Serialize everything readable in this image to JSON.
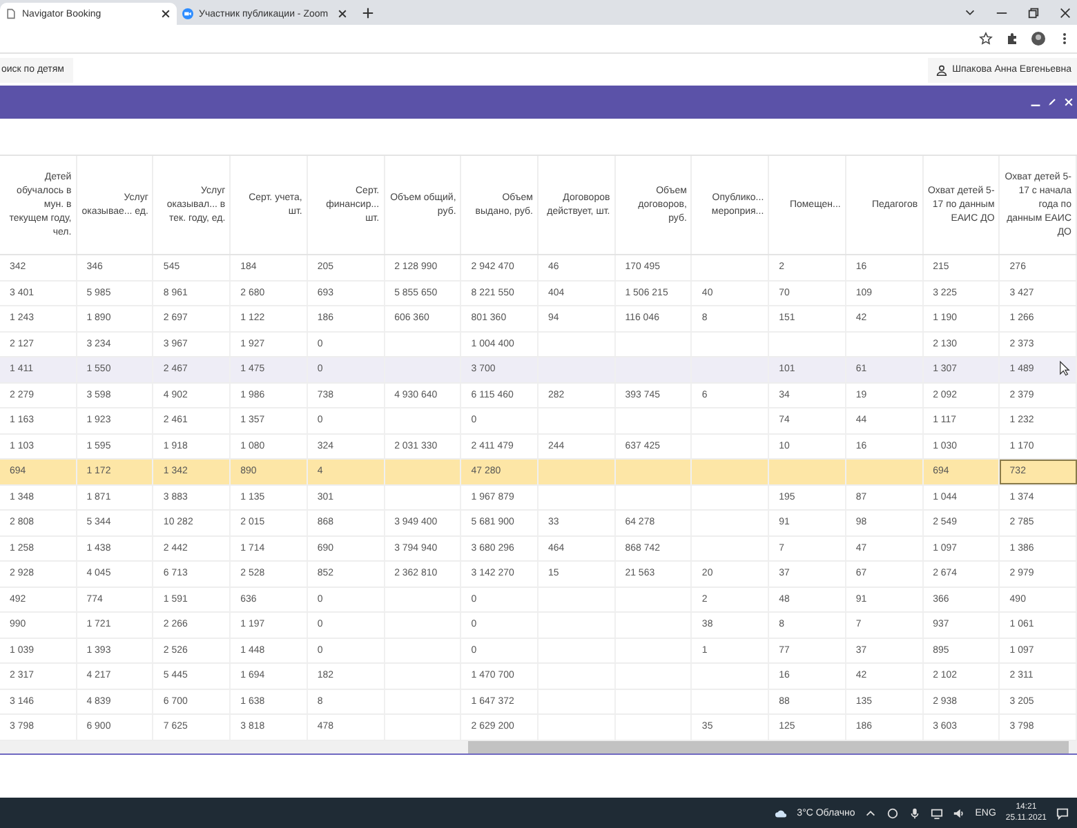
{
  "browser": {
    "tabs": [
      {
        "title": "Navigator Booking",
        "selected": true
      },
      {
        "title": "Участник публикации - Zoom",
        "selected": false
      }
    ]
  },
  "header": {
    "search_button": "оиск по детям",
    "user": "Шпакова Анна Евгеньевна"
  },
  "table": {
    "columns": [
      "Детей обучалось в мун. в текущем году, чел.",
      "Услуг оказывае... ед.",
      "Услуг оказывал... в тек. году, ед.",
      "Серт. учета, шт.",
      "Серт. финансир... шт.",
      "Объем общий, руб.",
      "Объем выдано, руб.",
      "Договоров действует, шт.",
      "Объем договоров, руб.",
      "Опублико... мероприя...",
      "Помещен...",
      "Педагогов",
      "Охват детей 5-17 по данным ЕАИС ДО",
      "Охват детей 5-17 с начала года по данным ЕАИС ДО"
    ],
    "rows": [
      {
        "selected": false,
        "hovered": false,
        "cells": [
          "342",
          "346",
          "545",
          "184",
          "205",
          "2 128 990",
          "2 942 470",
          "46",
          "170 495",
          null,
          "2",
          "16",
          "215",
          "276"
        ]
      },
      {
        "selected": false,
        "hovered": false,
        "cells": [
          "3 401",
          "5 985",
          "8 961",
          "2 680",
          "693",
          "5 855 650",
          "8 221 550",
          "404",
          "1 506 215",
          "40",
          "70",
          "109",
          "3 225",
          "3 427"
        ]
      },
      {
        "selected": false,
        "hovered": false,
        "cells": [
          "1 243",
          "1 890",
          "2 697",
          "1 122",
          "186",
          "606 360",
          "801 360",
          "94",
          "116 046",
          "8",
          "151",
          "42",
          "1 190",
          "1 266"
        ]
      },
      {
        "selected": false,
        "hovered": false,
        "cells": [
          "2 127",
          "3 234",
          "3 967",
          "1 927",
          "0",
          null,
          "1 004 400",
          null,
          null,
          null,
          null,
          null,
          "2 130",
          "2 373"
        ]
      },
      {
        "selected": false,
        "hovered": true,
        "cells": [
          "1 411",
          "1 550",
          "2 467",
          "1 475",
          "0",
          null,
          "3 700",
          null,
          null,
          null,
          "101",
          "61",
          "1 307",
          "1 489"
        ]
      },
      {
        "selected": false,
        "hovered": false,
        "cells": [
          "2 279",
          "3 598",
          "4 902",
          "1 986",
          "738",
          "4 930 640",
          "6 115 460",
          "282",
          "393 745",
          "6",
          "34",
          "19",
          "2 092",
          "2 379"
        ]
      },
      {
        "selected": false,
        "hovered": false,
        "cells": [
          "1 163",
          "1 923",
          "2 461",
          "1 357",
          "0",
          null,
          "0",
          null,
          null,
          null,
          "74",
          "44",
          "1 117",
          "1 232"
        ]
      },
      {
        "selected": false,
        "hovered": false,
        "cells": [
          "1 103",
          "1 595",
          "1 918",
          "1 080",
          "324",
          "2 031 330",
          "2 411 479",
          "244",
          "637 425",
          null,
          "10",
          "16",
          "1 030",
          "1 170"
        ]
      },
      {
        "selected": true,
        "hovered": false,
        "cells": [
          "694",
          "1 172",
          "1 342",
          "890",
          "4",
          null,
          "47 280",
          null,
          null,
          null,
          null,
          null,
          "694",
          {
            "text": "732",
            "focused": true
          }
        ]
      },
      {
        "selected": false,
        "hovered": false,
        "cells": [
          "1 348",
          "1 871",
          "3 883",
          "1 135",
          "301",
          null,
          "1 967 879",
          null,
          null,
          null,
          "195",
          "87",
          "1 044",
          "1 374"
        ]
      },
      {
        "selected": false,
        "hovered": false,
        "cells": [
          "2 808",
          "5 344",
          "10 282",
          "2 015",
          "868",
          "3 949 400",
          "5 681 900",
          "33",
          "64 278",
          null,
          "91",
          "98",
          "2 549",
          "2 785"
        ]
      },
      {
        "selected": false,
        "hovered": false,
        "cells": [
          "1 258",
          "1 438",
          "2 442",
          "1 714",
          "690",
          "3 794 940",
          "3 680 296",
          "464",
          "868 742",
          null,
          "7",
          "47",
          "1 097",
          "1 386"
        ]
      },
      {
        "selected": false,
        "hovered": false,
        "cells": [
          "2 928",
          "4 045",
          "6 713",
          "2 528",
          "852",
          "2 362 810",
          "3 142 270",
          "15",
          "21 563",
          "20",
          "37",
          "67",
          "2 674",
          "2 979"
        ]
      },
      {
        "selected": false,
        "hovered": false,
        "cells": [
          "492",
          "774",
          "1 591",
          "636",
          "0",
          null,
          "0",
          null,
          null,
          "2",
          "48",
          "91",
          "366",
          "490"
        ]
      },
      {
        "selected": false,
        "hovered": false,
        "cells": [
          "990",
          "1 721",
          "2 266",
          "1 197",
          "0",
          null,
          "0",
          null,
          null,
          "38",
          "8",
          "7",
          "937",
          "1 061"
        ]
      },
      {
        "selected": false,
        "hovered": false,
        "cells": [
          "1 039",
          "1 393",
          "2 526",
          "1 448",
          "0",
          null,
          "0",
          null,
          null,
          "1",
          "77",
          "37",
          "895",
          "1 097"
        ]
      },
      {
        "selected": false,
        "hovered": false,
        "cells": [
          "2 317",
          "4 217",
          "5 445",
          "1 694",
          "182",
          null,
          "1 470 700",
          null,
          null,
          null,
          "16",
          "42",
          "2 102",
          "2 311"
        ]
      },
      {
        "selected": false,
        "hovered": false,
        "cells": [
          "3 146",
          "4 839",
          "6 700",
          "1 638",
          "8",
          null,
          "1 647 372",
          null,
          null,
          null,
          "88",
          "135",
          "2 938",
          "3 205"
        ]
      },
      {
        "selected": false,
        "hovered": false,
        "cells": [
          "3 798",
          "6 900",
          "7 625",
          "3 818",
          "478",
          null,
          "2 629 200",
          null,
          null,
          "35",
          "125",
          "186",
          "3 603",
          "3 798"
        ]
      }
    ]
  },
  "taskbar": {
    "weather": "3°C Облачно",
    "language": "ENG",
    "time": "14:21",
    "date": "25.11.2021"
  }
}
